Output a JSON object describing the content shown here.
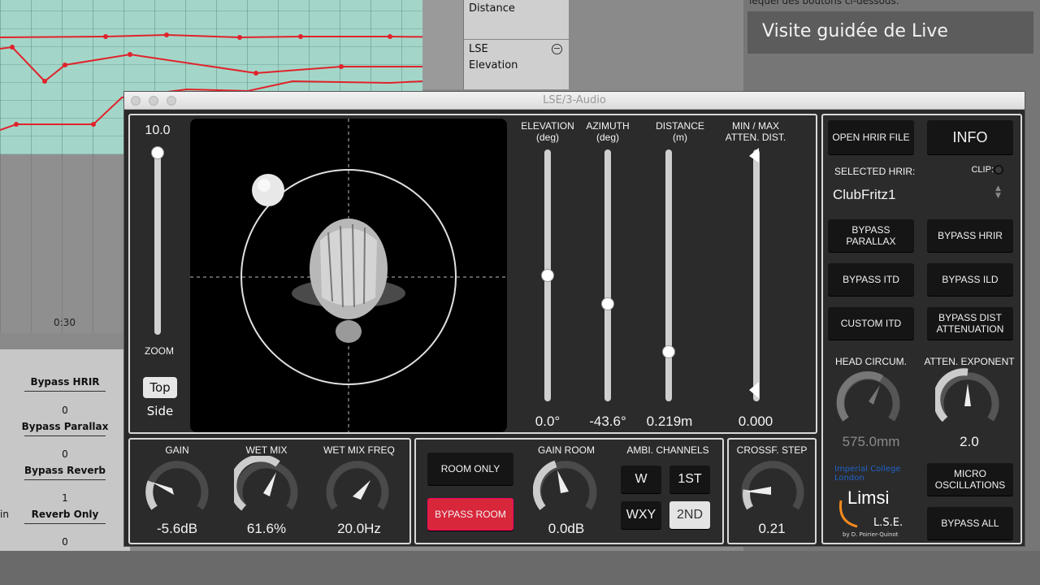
{
  "background": {
    "lane_distance": "Distance",
    "lane_name": "LSE",
    "lane_elevation": "Elevation",
    "time_marker": "0:30",
    "visite_title": "Visite guidée de Live",
    "visite_sub": "lequel des boutons ci-dessous.",
    "devices": [
      {
        "label": "Bypass HRIR",
        "value": "0"
      },
      {
        "label": "Bypass Parallax",
        "value": "0"
      },
      {
        "label": "Bypass Reverb",
        "value": "1"
      },
      {
        "label": "Reverb Only",
        "value": "0"
      }
    ],
    "side_in": "in"
  },
  "window": {
    "title": "LSE/3-Audio"
  },
  "zoom": {
    "value": "10.0",
    "label": "ZOOM",
    "top_btn": "Top",
    "side_btn": "Side",
    "level": 1.0
  },
  "sliders": [
    {
      "label1": "ELEVATION",
      "label2": "(deg)",
      "value": "0.0°",
      "level": 0.5
    },
    {
      "label1": "AZIMUTH",
      "label2": "(deg)",
      "value": "-43.6°",
      "level": 0.38
    },
    {
      "label1": "DISTANCE",
      "label2": "(m)",
      "value": "0.219m",
      "level": 0.18
    },
    {
      "label1": "MIN / MAX",
      "label2": "ATTEN. DIST.",
      "value": "0.000"
    }
  ],
  "right": {
    "open_hrir": "OPEN HRIR FILE",
    "info": "INFO",
    "selected_hrir_label": "SELECTED HRIR:",
    "clip_label": "CLIP:",
    "selected_hrir": "ClubFritz1",
    "bypass_parallax": "BYPASS PARALLAX",
    "bypass_hrir": "BYPASS HRIR",
    "bypass_itd": "BYPASS ITD",
    "bypass_ild": "BYPASS ILD",
    "custom_itd": "CUSTOM ITD",
    "bypass_dist": "BYPASS DIST ATTENUATION",
    "head_circ_label": "HEAD CIRCUM.",
    "head_circ_value": "575.0mm",
    "atten_exp_label": "ATTEN. EXPONENT",
    "atten_exp_value": "2.0",
    "imperial": "Imperial College London",
    "limsi": "Limsi",
    "lse": "L.S.E.",
    "credit": "by D. Poirier-Quinot",
    "micro_osc": "MICRO OSCILLATIONS",
    "bypass_all": "BYPASS ALL"
  },
  "bottom": {
    "gain_label": "GAIN",
    "gain_value": "-5.6dB",
    "wet_label": "WET MIX",
    "wet_value": "61.6%",
    "wetfreq_label": "WET MIX FREQ",
    "wetfreq_value": "20.0Hz",
    "room_only": "ROOM ONLY",
    "bypass_room": "BYPASS ROOM",
    "gain_room_label": "GAIN ROOM",
    "gain_room_value": "0.0dB",
    "ambi_label": "AMBI. CHANNELS",
    "w": "W",
    "first": "1ST",
    "wxy": "WXY",
    "second": "2ND",
    "crossf_label": "CROSSF. STEP",
    "crossf_value": "0.21"
  },
  "colors": {
    "accent_red": "#d8263a",
    "panel_bg": "#2b2b2b",
    "panel_border": "#d8d8d8",
    "lane_red": "#e0232b",
    "arrangement": "#a3d6c8"
  }
}
